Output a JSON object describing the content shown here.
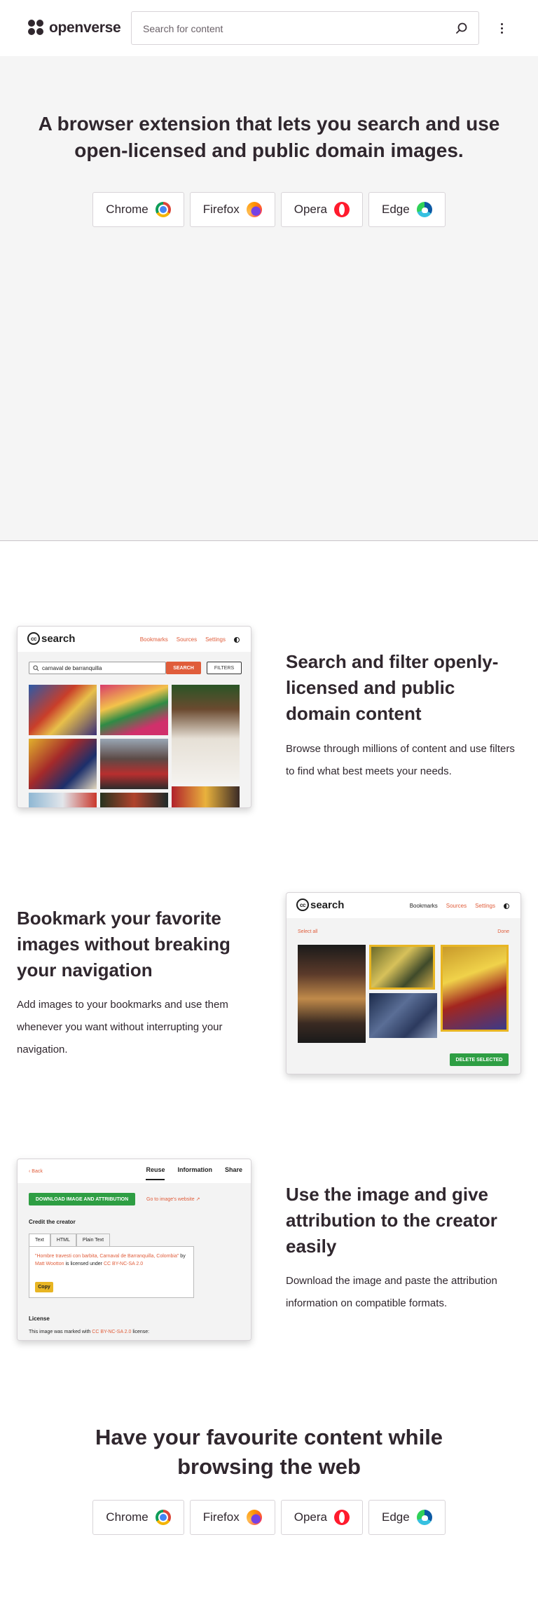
{
  "header": {
    "logo_text": "openverse",
    "search_placeholder": "Search for content"
  },
  "hero": {
    "title": "A browser extension that lets you search and use open-licensed and public domain images.",
    "browsers": [
      "Chrome",
      "Firefox",
      "Opera",
      "Edge"
    ]
  },
  "feature1": {
    "title": "Search and filter openly-licensed and public domain content",
    "description": "Browse through millions of content and use filters to find what best meets your needs.",
    "ui": {
      "logo_text": "search",
      "nav": [
        "Bookmarks",
        "Sources",
        "Settings"
      ],
      "query": "carnaval de barranquilla",
      "search_button": "SEARCH",
      "filters_button": "FILTERS"
    }
  },
  "feature2": {
    "title": "Bookmark your favorite images without breaking your navigation",
    "description": "Add images to your bookmarks and use them whenever you want without interrupting your navigation.",
    "ui": {
      "logo_text": "search",
      "nav": [
        "Bookmarks",
        "Sources",
        "Settings"
      ],
      "select_all": "Select all",
      "done": "Done",
      "delete_button": "DELETE SELECTED"
    }
  },
  "feature3": {
    "title": "Use the image and give attribution to the creator easily",
    "description": "Download the image and paste the attribution information on compatible formats.",
    "ui": {
      "back": "Back",
      "tabs": [
        "Reuse",
        "Information",
        "Share"
      ],
      "download_button": "DOWNLOAD IMAGE AND ATTRIBUTION",
      "website_link": "Go to image's website",
      "credit_heading": "Credit the creator",
      "format_tabs": [
        "Text",
        "HTML",
        "Plain Text"
      ],
      "attribution_title": "\"Hombre travesti con barbita, Carnaval de Barranquilla, Colombia\"",
      "attribution_by": " by ",
      "attribution_author": "Matt Wootton",
      "attribution_licensed": " is licensed under ",
      "attribution_license": "CC BY-NC-SA 2.0",
      "copy_button": "Copy",
      "license_heading": "License",
      "license_text_pre": "This image was marked with ",
      "license_name": "CC BY-NC-SA 2.0",
      "license_text_post": " license:"
    }
  },
  "footer_cta": {
    "title": "Have your favourite content while browsing the web",
    "browsers": [
      "Chrome",
      "Firefox",
      "Opera",
      "Edge"
    ]
  }
}
